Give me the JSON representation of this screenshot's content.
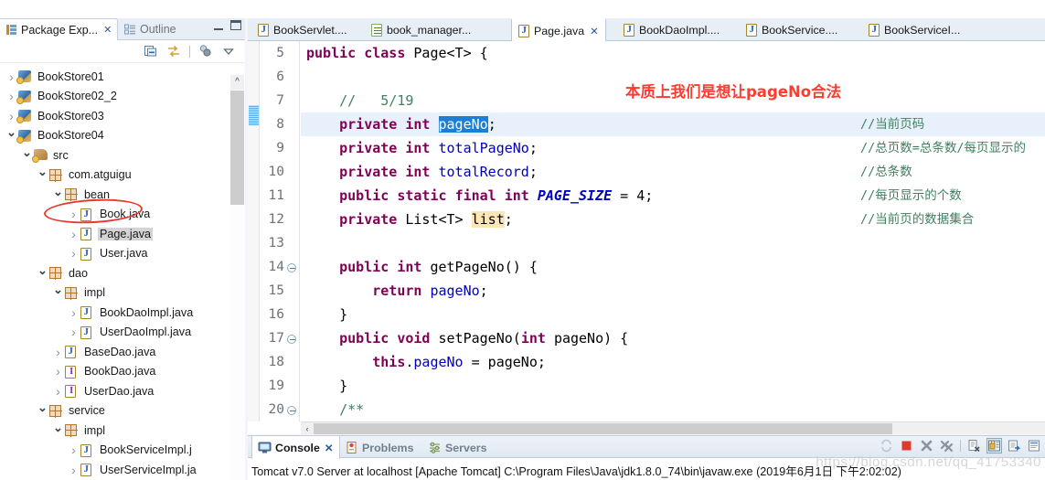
{
  "left_panel": {
    "tabs": [
      {
        "label": "Package Exp...",
        "icon": "package-explorer-icon",
        "active": true,
        "close": "✕"
      },
      {
        "label": "Outline",
        "icon": "outline-icon",
        "active": false
      }
    ],
    "window_controls": {
      "minimize": "minimize-icon",
      "maximize": "maximize-icon"
    },
    "toolbar_icons": [
      "collapse-all-icon",
      "link-with-editor-icon",
      "separator",
      "view-menu-filter-icon",
      "view-menu-icon"
    ],
    "tree": [
      {
        "indent": 0,
        "arrow": "closed",
        "icon": "java-project-icon",
        "label": "BookStore01",
        "selected": false
      },
      {
        "indent": 0,
        "arrow": "closed",
        "icon": "java-project-icon",
        "label": "BookStore02_2",
        "selected": false
      },
      {
        "indent": 0,
        "arrow": "closed",
        "icon": "java-project-icon",
        "label": "BookStore03",
        "selected": false
      },
      {
        "indent": 0,
        "arrow": "open",
        "icon": "java-project-icon",
        "label": "BookStore04",
        "selected": false
      },
      {
        "indent": 1,
        "arrow": "open",
        "icon": "source-folder-icon",
        "label": "src",
        "selected": false
      },
      {
        "indent": 2,
        "arrow": "open",
        "icon": "package-icon",
        "label": "com.atguigu",
        "selected": false
      },
      {
        "indent": 3,
        "arrow": "open",
        "icon": "package-icon",
        "label": "bean",
        "selected": false
      },
      {
        "indent": 4,
        "arrow": "closed",
        "icon": "java-file-icon",
        "label": "Book.java",
        "selected": false
      },
      {
        "indent": 4,
        "arrow": "closed",
        "icon": "java-file-icon",
        "label": "Page.java",
        "selected": true
      },
      {
        "indent": 4,
        "arrow": "closed",
        "icon": "java-file-icon",
        "label": "User.java",
        "selected": false
      },
      {
        "indent": 2,
        "arrow": "open",
        "icon": "package-icon",
        "label": "dao",
        "selected": false
      },
      {
        "indent": 3,
        "arrow": "open",
        "icon": "package-icon",
        "label": "impl",
        "selected": false
      },
      {
        "indent": 4,
        "arrow": "closed",
        "icon": "java-file-icon",
        "label": "BookDaoImpl.java",
        "selected": false
      },
      {
        "indent": 4,
        "arrow": "closed",
        "icon": "java-file-icon",
        "label": "UserDaoImpl.java",
        "selected": false
      },
      {
        "indent": 3,
        "arrow": "closed",
        "icon": "java-file-icon",
        "label": "BaseDao.java",
        "selected": false
      },
      {
        "indent": 3,
        "arrow": "closed",
        "icon": "java-interface-icon",
        "label": "BookDao.java",
        "selected": false
      },
      {
        "indent": 3,
        "arrow": "closed",
        "icon": "java-interface-icon",
        "label": "UserDao.java",
        "selected": false
      },
      {
        "indent": 2,
        "arrow": "open",
        "icon": "package-icon",
        "label": "service",
        "selected": false
      },
      {
        "indent": 3,
        "arrow": "open",
        "icon": "package-icon",
        "label": "impl",
        "selected": false
      },
      {
        "indent": 4,
        "arrow": "closed",
        "icon": "java-file-icon",
        "label": "BookServiceImpl.j",
        "selected": false
      },
      {
        "indent": 4,
        "arrow": "closed",
        "icon": "java-file-icon",
        "label": "UserServiceImpl.ja",
        "selected": false
      }
    ],
    "scroll_up_glyph": "^"
  },
  "editor": {
    "tabs": [
      {
        "label": "BookServlet....",
        "icon": "java-file-icon",
        "active": false
      },
      {
        "label": "book_manager...",
        "icon": "xml-file-icon",
        "active": false
      },
      {
        "label": "Page.java",
        "icon": "java-file-icon",
        "active": true,
        "close": "✕"
      },
      {
        "label": "BookDaoImpl....",
        "icon": "java-file-icon",
        "active": false
      },
      {
        "label": "BookService....",
        "icon": "java-file-icon",
        "active": false
      },
      {
        "label": "BookServiceI...",
        "icon": "java-file-icon",
        "active": false
      }
    ],
    "line_numbers": [
      "5",
      "6",
      "7",
      "8",
      "9",
      "10",
      "11",
      "12",
      "13",
      "14",
      "15",
      "16",
      "17",
      "18",
      "19",
      "20"
    ],
    "fold_lines": [
      "14",
      "17",
      "20"
    ],
    "current_line": "8",
    "lines": [
      {
        "n": "5",
        "segs": [
          {
            "t": "public ",
            "c": "kw"
          },
          {
            "t": "class ",
            "c": "kw"
          },
          {
            "t": "Page<T> {",
            "c": "pln"
          }
        ]
      },
      {
        "n": "6",
        "segs": []
      },
      {
        "n": "7",
        "segs": [
          {
            "t": "    ",
            "c": "pln"
          },
          {
            "t": "//   5/19",
            "c": "cmt"
          }
        ]
      },
      {
        "n": "8",
        "segs": [
          {
            "t": "    ",
            "c": "pln"
          },
          {
            "t": "private ",
            "c": "kw"
          },
          {
            "t": "int ",
            "c": "kw"
          },
          {
            "t": "pageNo",
            "c": "selbox"
          },
          {
            "t": ";",
            "c": "pln"
          }
        ]
      },
      {
        "n": "9",
        "segs": [
          {
            "t": "    ",
            "c": "pln"
          },
          {
            "t": "private ",
            "c": "kw"
          },
          {
            "t": "int ",
            "c": "kw"
          },
          {
            "t": "totalPageNo",
            "c": "fld"
          },
          {
            "t": ";",
            "c": "pln"
          }
        ]
      },
      {
        "n": "10",
        "segs": [
          {
            "t": "    ",
            "c": "pln"
          },
          {
            "t": "private ",
            "c": "kw"
          },
          {
            "t": "int ",
            "c": "kw"
          },
          {
            "t": "totalRecord",
            "c": "fld"
          },
          {
            "t": ";",
            "c": "pln"
          }
        ]
      },
      {
        "n": "11",
        "segs": [
          {
            "t": "    ",
            "c": "pln"
          },
          {
            "t": "public ",
            "c": "kw"
          },
          {
            "t": "static ",
            "c": "kw"
          },
          {
            "t": "final ",
            "c": "kw"
          },
          {
            "t": "int ",
            "c": "kw"
          },
          {
            "t": "PAGE_SIZE",
            "c": "fld-i"
          },
          {
            "t": " = ",
            "c": "pln"
          },
          {
            "t": "4",
            "c": "num"
          },
          {
            "t": ";",
            "c": "pln"
          }
        ]
      },
      {
        "n": "12",
        "segs": [
          {
            "t": "    ",
            "c": "pln"
          },
          {
            "t": "private ",
            "c": "kw"
          },
          {
            "t": "List<T> ",
            "c": "pln"
          },
          {
            "t": "list",
            "c": "occbox"
          },
          {
            "t": ";",
            "c": "pln"
          }
        ]
      },
      {
        "n": "13",
        "segs": []
      },
      {
        "n": "14",
        "segs": [
          {
            "t": "    ",
            "c": "pln"
          },
          {
            "t": "public ",
            "c": "kw"
          },
          {
            "t": "int ",
            "c": "kw"
          },
          {
            "t": "getPageNo() {",
            "c": "pln"
          }
        ]
      },
      {
        "n": "15",
        "segs": [
          {
            "t": "        ",
            "c": "pln"
          },
          {
            "t": "return ",
            "c": "kw"
          },
          {
            "t": "pageNo",
            "c": "fld"
          },
          {
            "t": ";",
            "c": "pln"
          }
        ]
      },
      {
        "n": "16",
        "segs": [
          {
            "t": "    }",
            "c": "pln"
          }
        ]
      },
      {
        "n": "17",
        "segs": [
          {
            "t": "    ",
            "c": "pln"
          },
          {
            "t": "public ",
            "c": "kw"
          },
          {
            "t": "void ",
            "c": "kw"
          },
          {
            "t": "setPageNo(",
            "c": "pln"
          },
          {
            "t": "int ",
            "c": "kw"
          },
          {
            "t": "pageNo) {",
            "c": "pln"
          }
        ]
      },
      {
        "n": "18",
        "segs": [
          {
            "t": "        ",
            "c": "pln"
          },
          {
            "t": "this",
            "c": "kw"
          },
          {
            "t": ".",
            "c": "pln"
          },
          {
            "t": "pageNo",
            "c": "fld"
          },
          {
            "t": " = pageNo;",
            "c": "pln"
          }
        ]
      },
      {
        "n": "19",
        "segs": [
          {
            "t": "    }",
            "c": "pln"
          }
        ]
      },
      {
        "n": "20",
        "segs": [
          {
            "t": "    ",
            "c": "pln"
          },
          {
            "t": "/**",
            "c": "cmt"
          }
        ]
      }
    ],
    "right_comments": [
      {
        "line": "8",
        "text": "//当前页码"
      },
      {
        "line": "9",
        "text": "//总页数=总条数/每页显示的"
      },
      {
        "line": "10",
        "text": "//总条数"
      },
      {
        "line": "11",
        "text": "//每页显示的个数"
      },
      {
        "line": "12",
        "text": "//当前页的数据集合"
      }
    ],
    "annotation": "本质上我们是想让pageNo合法",
    "hscroll_left_glyph": "‹"
  },
  "console": {
    "tabs": [
      {
        "label": "Console",
        "icon": "console-icon",
        "active": true,
        "close": "✕"
      },
      {
        "label": "Problems",
        "icon": "problems-icon",
        "active": false
      },
      {
        "label": "Servers",
        "icon": "servers-icon",
        "active": false
      }
    ],
    "toolbar_icons": [
      "refresh-icon",
      "terminate-icon",
      "remove-launch-icon",
      "remove-all-icon",
      "separator",
      "clear-console-icon",
      "scroll-lock-icon",
      "pin-console-icon",
      "display-console-icon"
    ],
    "body_text": "Tomcat v7.0 Server at localhost [Apache Tomcat] C:\\Program Files\\Java\\jdk1.8.0_74\\bin\\javaw.exe (2019年6月1日 下午2:02:02)"
  },
  "watermark": "https://blog.csdn.net/qq_41753340",
  "colors": {
    "keyword": "#7f0055",
    "field": "#0000c0",
    "comment": "#3f7f5f",
    "selection": "#1c7fd6",
    "occurrence": "#fbe6b4",
    "current_line": "#e8f1fb",
    "annotation_red": "#ff3b30",
    "tab_bar": "#e8eef5"
  }
}
